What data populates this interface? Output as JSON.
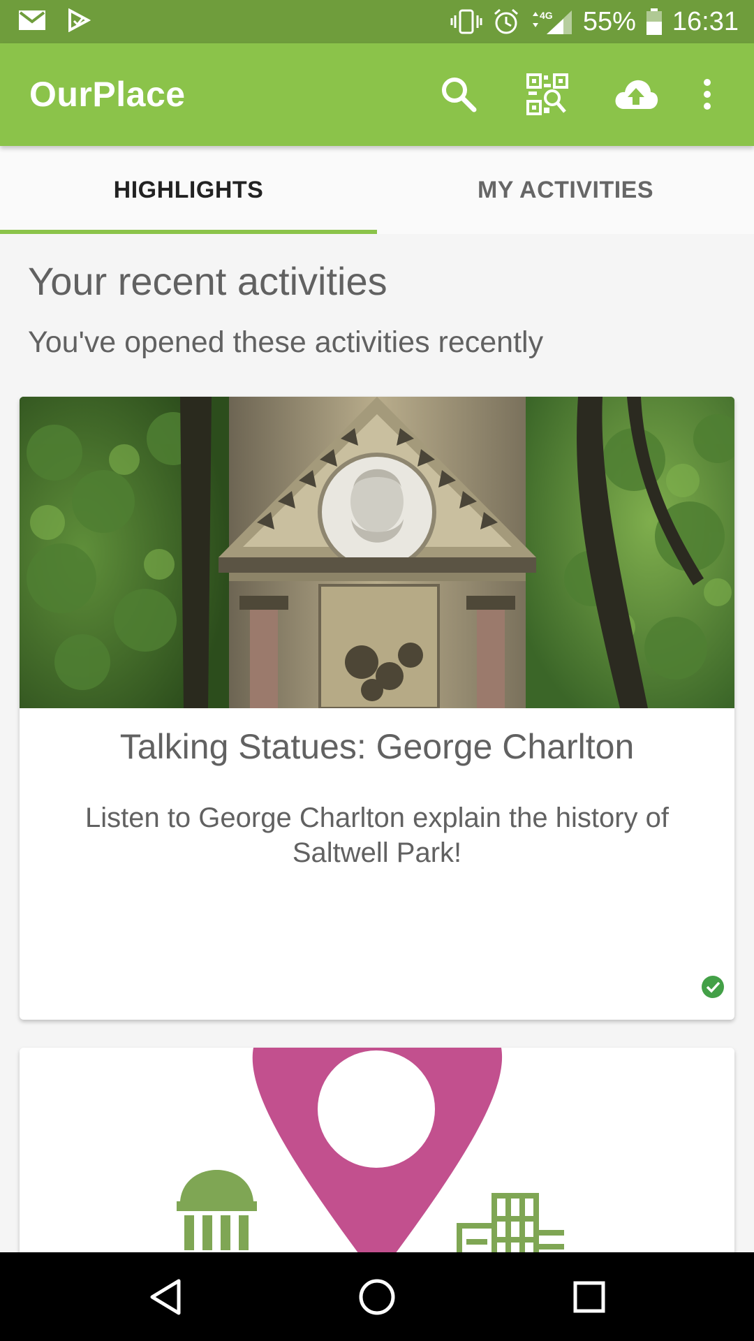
{
  "status_bar": {
    "battery": "55%",
    "time": "16:31",
    "network": "4G",
    "icons": [
      "gmail-icon",
      "play-store-icon",
      "vibrate-icon",
      "alarm-icon",
      "signal-icon",
      "battery-icon"
    ]
  },
  "app_bar": {
    "title": "OurPlace",
    "actions": [
      "search-icon",
      "qr-scan-icon",
      "cloud-upload-icon",
      "more-vert-icon"
    ]
  },
  "tabs": [
    {
      "label": "HIGHLIGHTS",
      "active": true
    },
    {
      "label": "MY ACTIVITIES",
      "active": false
    }
  ],
  "section": {
    "title": "Your recent activities",
    "subtitle": "You've opened these activities recently"
  },
  "cards": [
    {
      "title": "Talking Statues: George Charlton",
      "description": "Listen to George Charlton explain the history of Saltwell Park!",
      "completed": true
    },
    {
      "title": "",
      "description": ""
    }
  ],
  "nav_bar": {
    "buttons": [
      "back-icon",
      "home-icon",
      "recents-icon"
    ]
  },
  "colors": {
    "status_bar": "#6f9d3c",
    "app_bar": "#8bc34a",
    "tab_indicator": "#8bc34a",
    "pin": "#c2508e",
    "check": "#43a047"
  }
}
